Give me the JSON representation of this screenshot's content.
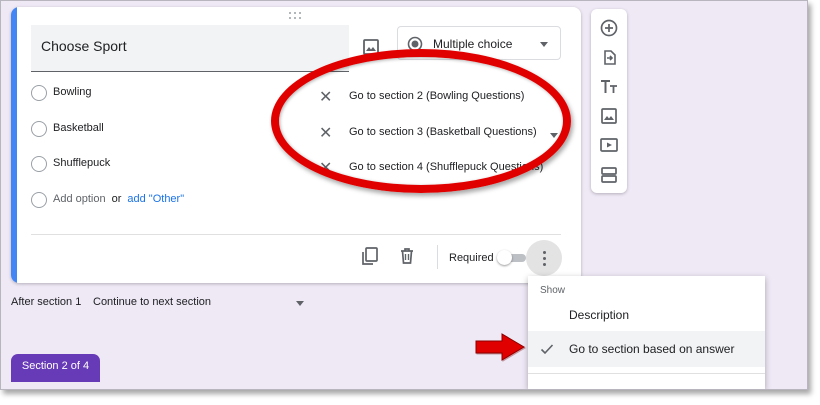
{
  "question": {
    "title": "Choose Sport",
    "type_label": "Multiple choice",
    "options": [
      {
        "label": "Bowling",
        "goto": "Go to section 2 (Bowling Questions)"
      },
      {
        "label": "Basketball",
        "goto": "Go to section 3 (Basketball Questions)"
      },
      {
        "label": "Shufflepuck",
        "goto": "Go to section 4 (Shufflepuck Questions)"
      }
    ],
    "add_option": "Add option",
    "or_text": "or",
    "add_other": "add \"Other\"",
    "required_label": "Required",
    "required_on": false
  },
  "after_section": {
    "label": "After section 1",
    "value": "Continue to next section"
  },
  "section_tab": "Section 2 of 4",
  "menu": {
    "header": "Show",
    "items": [
      {
        "label": "Description",
        "checked": false
      },
      {
        "label": "Go to section based on answer",
        "checked": true
      }
    ]
  },
  "colors": {
    "accent": "#4285f4",
    "section_tab": "#673ab7",
    "highlight_oval": "#e10000",
    "arrow": "#e10000",
    "link": "#1a73e8"
  },
  "icons": {
    "toolbar": [
      "add-question-icon",
      "import-questions-icon",
      "add-title-icon",
      "add-image-icon",
      "add-video-icon",
      "add-section-icon"
    ],
    "footer": [
      "duplicate-icon",
      "delete-icon",
      "more-options-icon"
    ]
  }
}
